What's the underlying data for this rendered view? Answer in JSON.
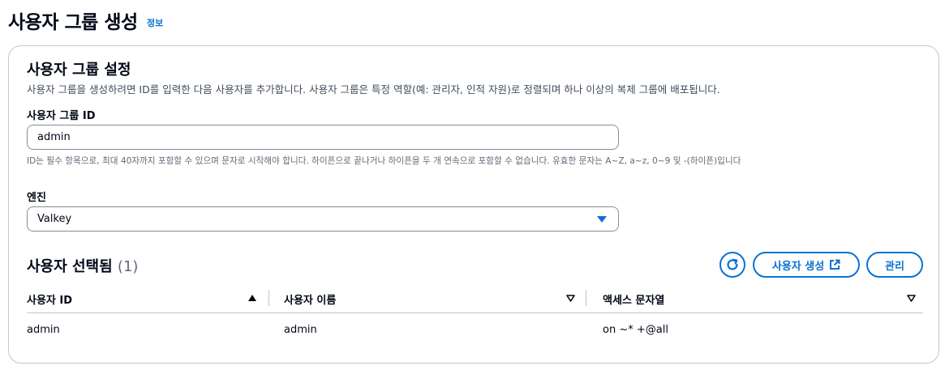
{
  "page": {
    "title": "사용자 그룹 생성",
    "info_link": "정보"
  },
  "settings": {
    "title": "사용자 그룹 설정",
    "description": "사용자 그룹을 생성하려면 ID를 입력한 다음 사용자를 추가합니다. 사용자 그룹은 특정 역할(예: 관리자, 인적 자원)로 정렬되며 하나 이상의 복제 그룹에 배포됩니다.",
    "group_id_label": "사용자 그룹 ID",
    "group_id_value": "admin",
    "group_id_hint": "ID는 필수 항목으로, 최대 40자까지 포함할 수 있으며 문자로 시작해야 합니다. 하이픈으로 끝나거나 하이픈을 두 개 연속으로 포함할 수 없습니다. 유효한 문자는 A~Z, a~z, 0~9 및 -(하이픈)입니다",
    "engine_label": "엔진",
    "engine_value": "Valkey"
  },
  "users": {
    "title": "사용자 선택됨",
    "count": "(1)",
    "create_user_label": "사용자 생성",
    "manage_label": "관리",
    "columns": [
      "사용자 ID",
      "사용자 이름",
      "액세스 문자열"
    ],
    "rows": [
      [
        "admin",
        "admin",
        "on ~* +@all"
      ]
    ]
  },
  "colors": {
    "accent": "#0972d3",
    "border": "#c6c6cd",
    "text": "#000716"
  },
  "icons": {
    "refresh": "refresh-icon",
    "external": "external-link-icon",
    "caret": "caret-down-icon"
  }
}
